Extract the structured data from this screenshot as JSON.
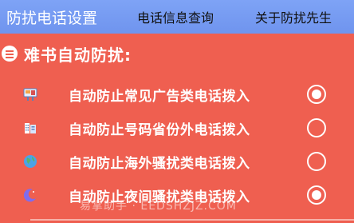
{
  "topbar": {
    "title": "防扰电话设置",
    "tab_phone_info": "电话信息查询",
    "tab_about": "关于防扰先生"
  },
  "section": {
    "title": "难书自动防扰:"
  },
  "options": [
    {
      "label": "自动防止常见广告类电话拨入",
      "checked": true,
      "icon": "billboard-icon"
    },
    {
      "label": "自动防止号码省份外电话拨入",
      "checked": false,
      "icon": "building-icon"
    },
    {
      "label": "自动防止海外骚扰类电话拨入",
      "checked": false,
      "icon": "globe-icon"
    },
    {
      "label": "自动防止夜间骚扰类电话拨入",
      "checked": true,
      "icon": "moon-icon"
    }
  ],
  "watermark": "易掌助手 · EEDSHZJZ.COM",
  "colors": {
    "background": "#ef5f50",
    "topbar": "#7ea3f6"
  }
}
